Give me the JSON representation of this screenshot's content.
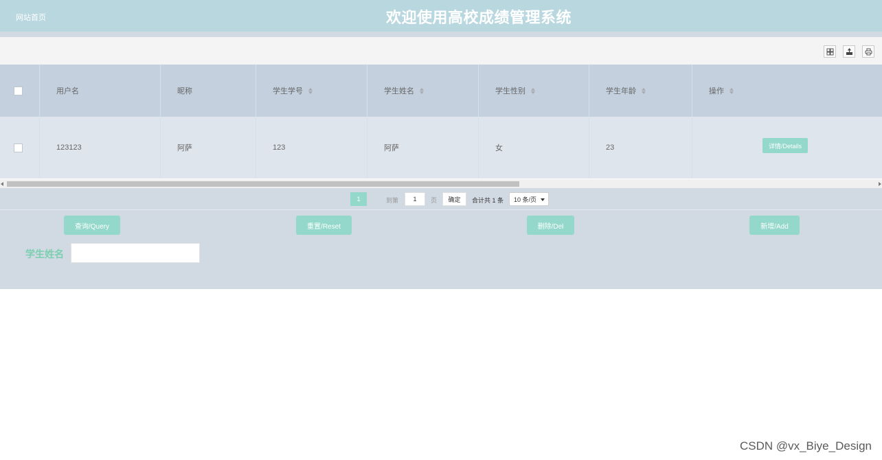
{
  "header": {
    "home_link": "网站首页",
    "title": "欢迎使用高校成绩管理系统"
  },
  "toolbar": {
    "icons": [
      "columns-icon",
      "export-icon",
      "print-icon"
    ]
  },
  "table": {
    "columns": [
      "用户名",
      "昵称",
      "学生学号",
      "学生姓名",
      "学生性别",
      "学生年龄",
      "操作"
    ],
    "rows": [
      {
        "username": "123123",
        "nickname": "阿萨",
        "student_no": "123",
        "student_name": "阿萨",
        "gender": "女",
        "age": "23",
        "action_label": "详情/Details"
      }
    ]
  },
  "pagination": {
    "current_page": "1",
    "goto_label": "到第",
    "goto_value": "1",
    "page_unit": "页",
    "confirm_label": "确定",
    "total_text": "合计共 1 条",
    "page_size": "10 条/页"
  },
  "actions": {
    "query_label": "查询/Query",
    "reset_label": "重置/Reset",
    "delete_label": "删除/Del",
    "add_label": "新增/Add"
  },
  "search": {
    "label": "学生姓名",
    "value": ""
  },
  "watermark": "CSDN @vx_Biye_Design",
  "colors": {
    "header_bg": "#b9d7df",
    "accent": "#93d8cb",
    "panel_bg": "#d1d9e3"
  }
}
